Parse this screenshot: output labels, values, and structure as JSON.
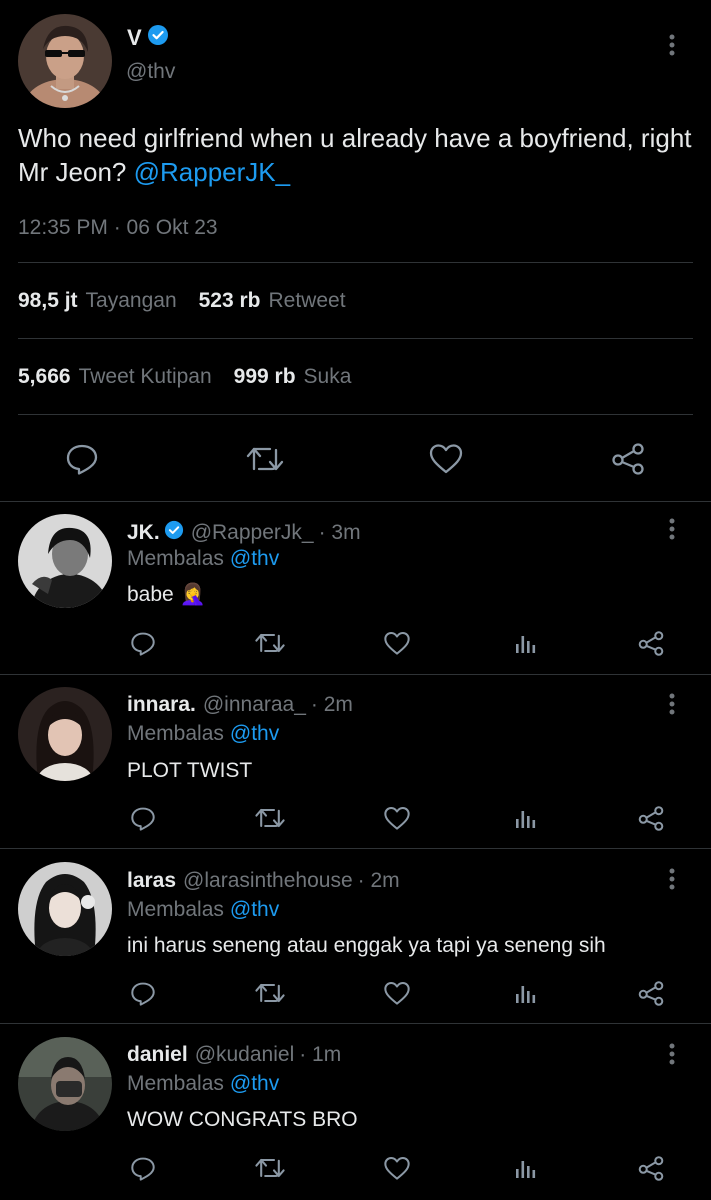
{
  "tweet": {
    "author_name": "V",
    "author_handle": "@thv",
    "text": "Who need girlfriend when u already have a boyfriend, right Mr Jeon?",
    "mention": "@RapperJK_",
    "timestamp": "12:35 PM · 06 Okt 23",
    "stats": {
      "views_value": "98,5 jt",
      "views_label": "Tayangan",
      "retweets_value": "523 rb",
      "retweets_label": "Retweet",
      "quotes_value": "5,666",
      "quotes_label": "Tweet Kutipan",
      "likes_value": "999 rb",
      "likes_label": "Suka"
    },
    "actions": [
      "reply-icon",
      "retweet-icon",
      "like-icon",
      "share-icon"
    ]
  },
  "replies": [
    {
      "name": "JK.",
      "verified": true,
      "handle": "@RapperJk_",
      "time": "· 3m",
      "replying_prefix": "Membalas",
      "replying_to": "@thv",
      "text": "babe 🤦‍♀️"
    },
    {
      "name": "innara.",
      "verified": false,
      "handle": "@innaraa_",
      "time": "· 2m",
      "replying_prefix": "Membalas",
      "replying_to": "@thv",
      "text": "PLOT TWIST"
    },
    {
      "name": "laras",
      "verified": false,
      "handle": "@larasinthehouse",
      "time": "· 2m",
      "replying_prefix": "Membalas",
      "replying_to": "@thv",
      "text": "ini harus seneng atau enggak ya tapi ya seneng sih"
    },
    {
      "name": "daniel",
      "verified": false,
      "handle": "@kudaniel",
      "time": "· 1m",
      "replying_prefix": "Membalas",
      "replying_to": "@thv",
      "text": "WOW CONGRATS BRO"
    }
  ],
  "colors": {
    "background": "#000000",
    "text": "#e7e9ea",
    "muted": "#71767b",
    "accent": "#1d9bf0",
    "divider": "#2f3336"
  }
}
